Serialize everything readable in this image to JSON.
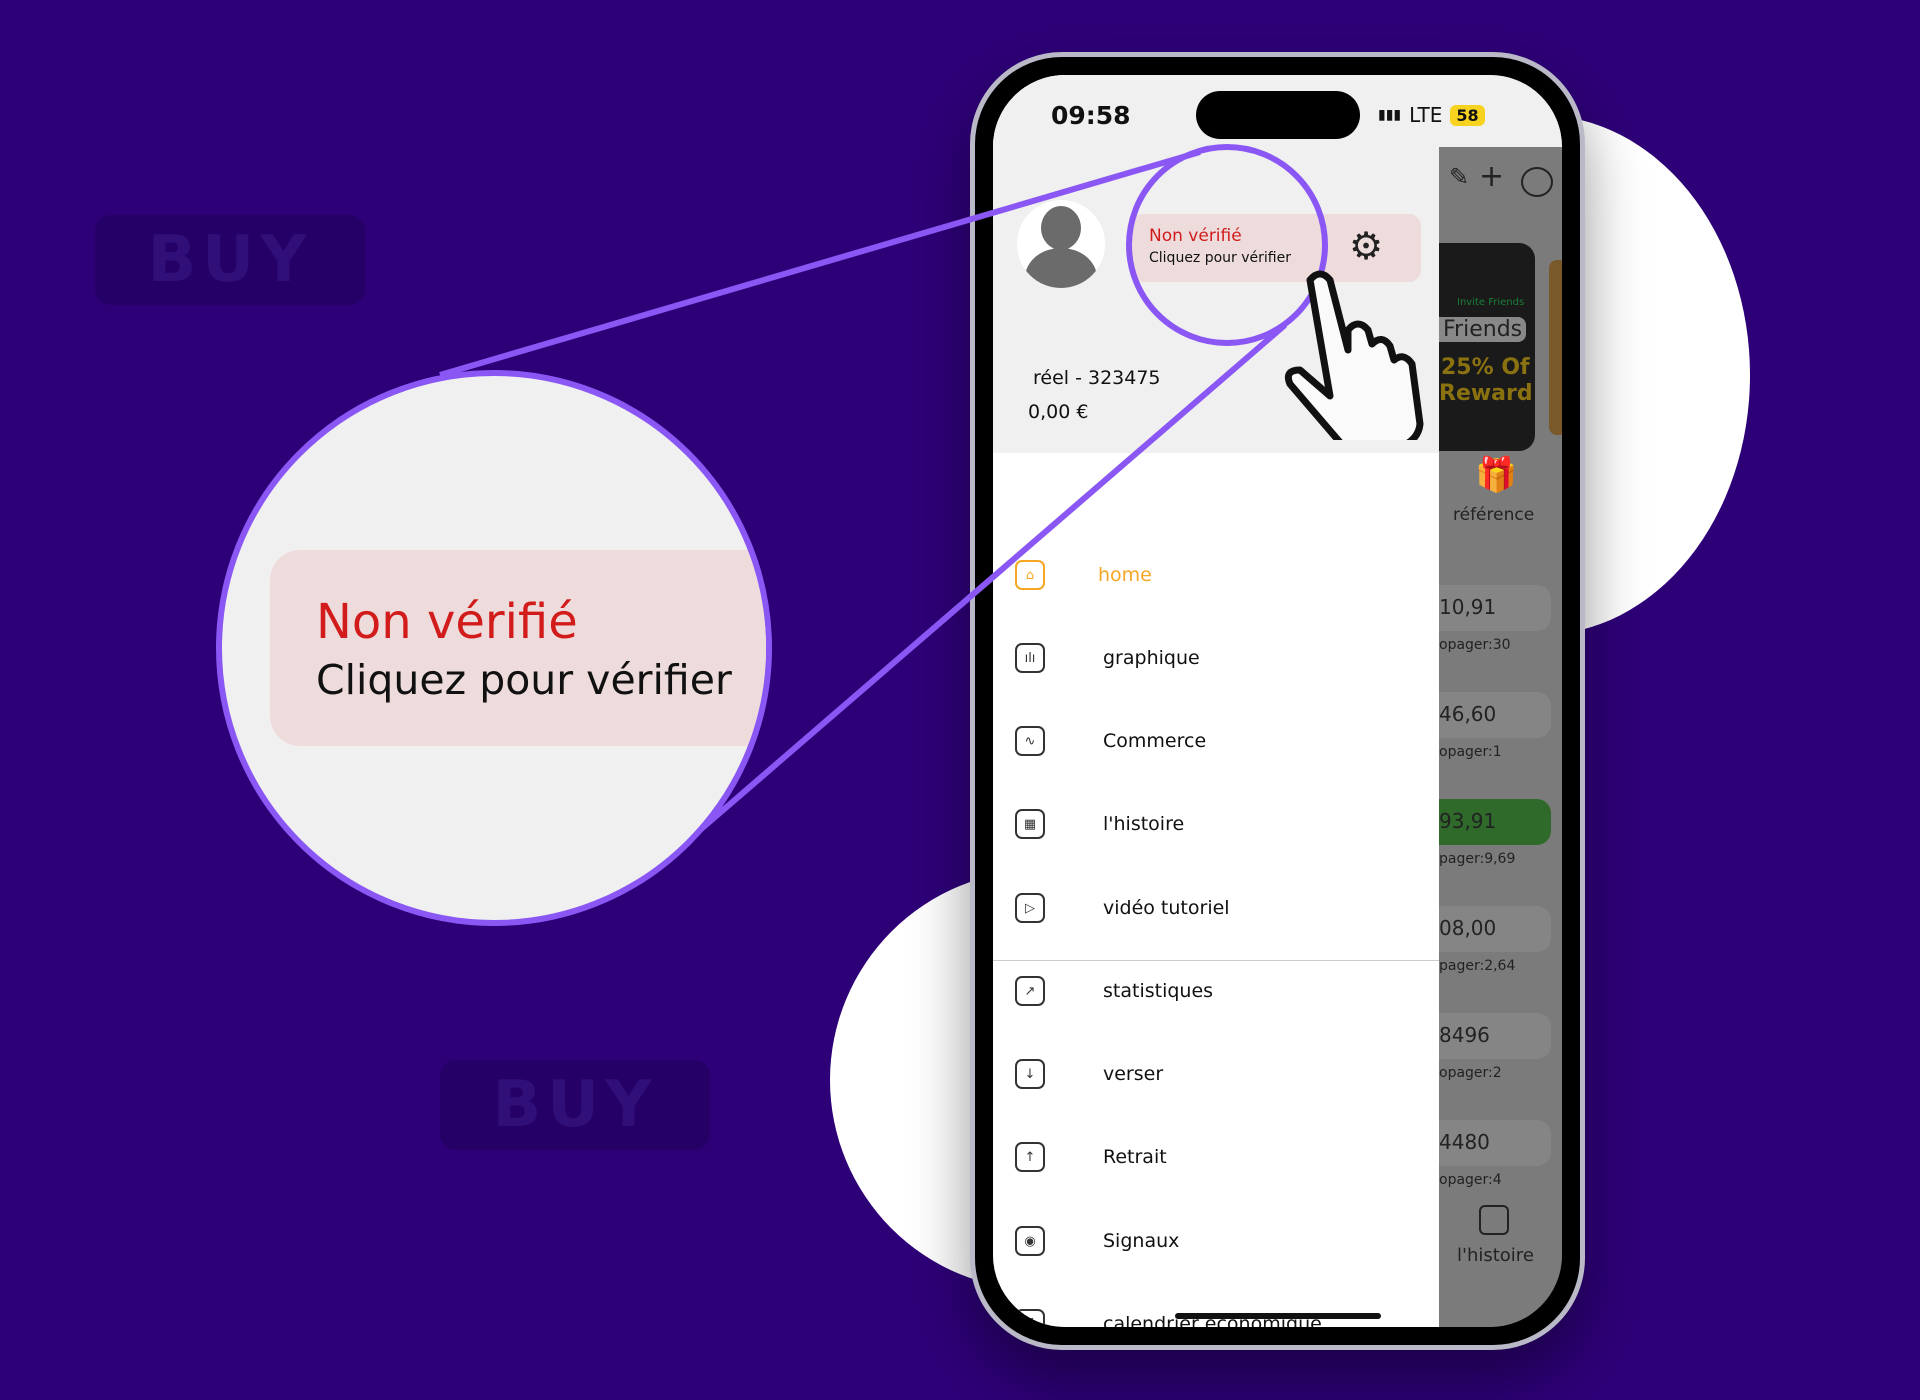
{
  "background": {
    "color": "#2e0078",
    "ghost_buttons": [
      "BUY",
      "BUY"
    ]
  },
  "status_bar": {
    "time": "09:58",
    "network": "LTE",
    "battery": "58"
  },
  "drawer": {
    "account": {
      "label": "réel - 323475",
      "balance": "0,00 €"
    },
    "verification": {
      "status": "Non vérifié",
      "action": "Cliquez pour vérifier",
      "status_color": "#d21c1c"
    },
    "menu": [
      {
        "label": "home",
        "icon": "home-icon",
        "active": true
      },
      {
        "label": "graphique",
        "icon": "chart-icon"
      },
      {
        "label": "Commerce",
        "icon": "trade-icon"
      },
      {
        "label": "l'histoire",
        "icon": "calendar-icon"
      },
      {
        "label": "vidéo tutoriel",
        "icon": "video-icon"
      },
      {
        "label": "statistiques",
        "icon": "stats-icon"
      },
      {
        "label": "verser",
        "icon": "deposit-icon"
      },
      {
        "label": "Retrait",
        "icon": "withdraw-icon"
      },
      {
        "label": "Signaux",
        "icon": "signal-icon"
      },
      {
        "label": "calendrier économique",
        "icon": "calendar-7-icon"
      }
    ],
    "accent": "#f5a623"
  },
  "background_app": {
    "banner": {
      "small": "Invite Friends",
      "title": "Friends",
      "line1": "25% Of",
      "line2": "Reward"
    },
    "reference_label": "référence",
    "rows": [
      {
        "value": "10,91",
        "sub": "opager:30"
      },
      {
        "value": "46,60",
        "sub": "opager:1"
      },
      {
        "value": "93,91",
        "sub": "pager:9,69",
        "highlight": true
      },
      {
        "value": "08,00",
        "sub": "pager:2,64"
      },
      {
        "value": "8496",
        "sub": "opager:2"
      },
      {
        "value": "4480",
        "sub": "opager:4"
      }
    ],
    "tab_label": "l'histoire"
  },
  "magnifier": {
    "status": "Non vérifié",
    "action": "Cliquez pour vérifier",
    "ring_color": "#8a57f5"
  }
}
